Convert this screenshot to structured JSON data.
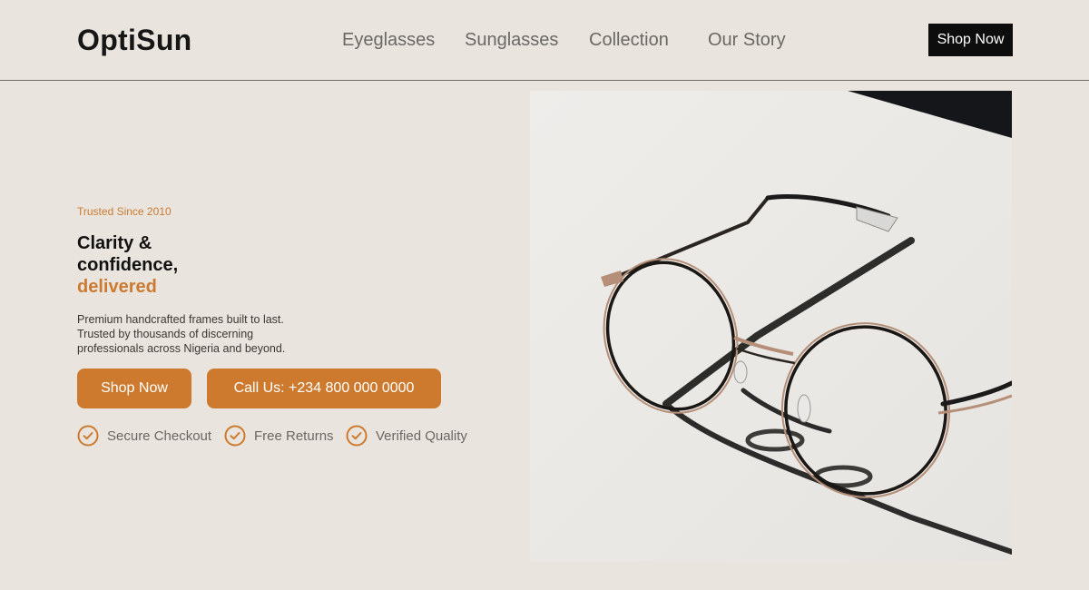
{
  "brand": {
    "name": "OptiSun"
  },
  "nav": {
    "items": [
      {
        "label": "Eyeglasses"
      },
      {
        "label": "Sunglasses"
      },
      {
        "label": "Collection"
      },
      {
        "label": "Our Story"
      }
    ],
    "cta_label": "Shop Now"
  },
  "hero": {
    "eyebrow": "Trusted Since 2010",
    "headline_line1": "Clarity &",
    "headline_line2": "confidence,",
    "headline_accent": "delivered",
    "description": "Premium handcrafted frames built to last. Trusted by thousands of discerning professionals across Nigeria and beyond.",
    "primary_button": "Shop Now",
    "secondary_button": "Call Us: +234 800 000 0000",
    "features": [
      {
        "label": "Secure Checkout",
        "icon": "check-circle-icon"
      },
      {
        "label": "Free Returns",
        "icon": "check-circle-icon"
      },
      {
        "label": "Verified Quality",
        "icon": "check-circle-icon"
      }
    ],
    "image_subject": "eyeglasses-photo"
  },
  "colors": {
    "background": "#e9e5de",
    "accent": "#cd7a2f",
    "dark": "#0d0d0d",
    "muted_text": "#6a6864"
  }
}
